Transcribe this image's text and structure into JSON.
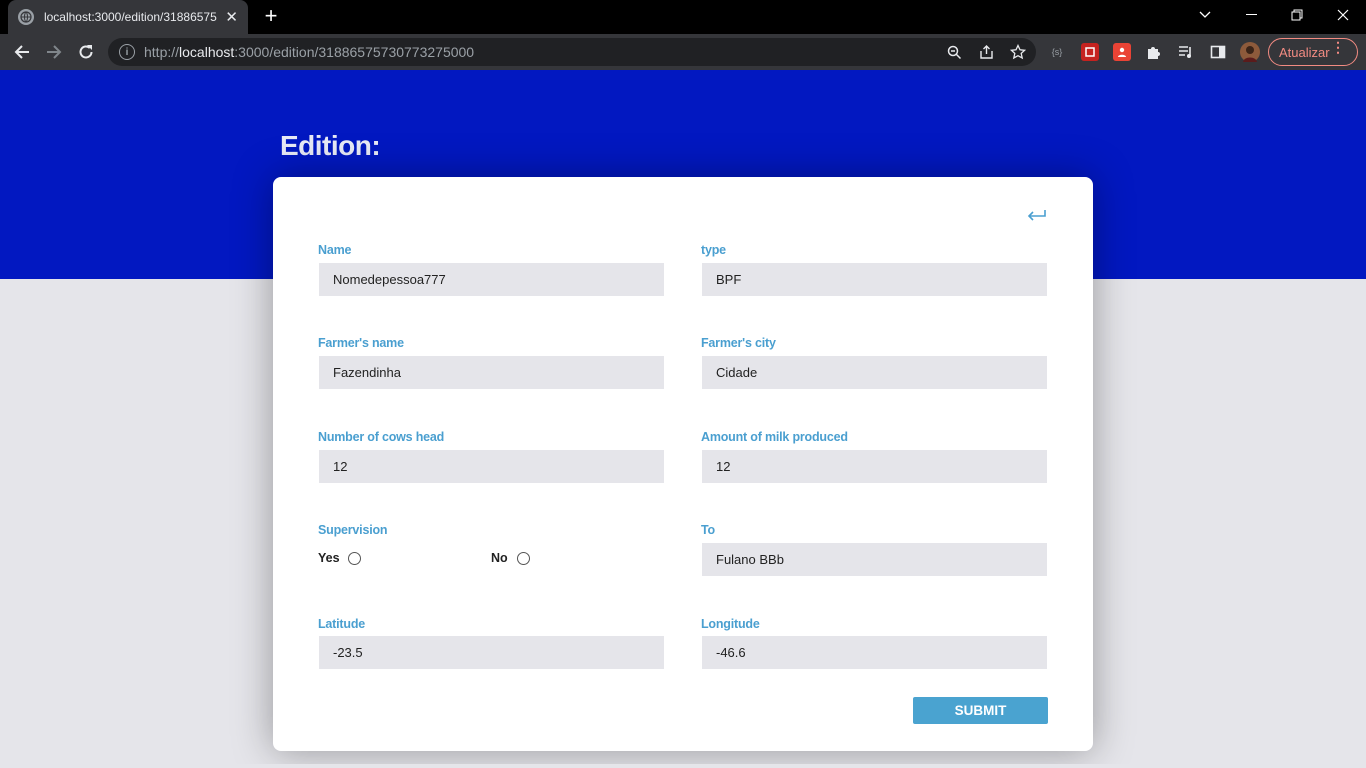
{
  "browser": {
    "tab_title": "localhost:3000/edition/31886575",
    "tab_close": "✕",
    "new_tab": "+",
    "url_scheme": "http://",
    "url_host": "localhost",
    "url_path": ":3000/edition/31886575730773275000",
    "update_label": "Atualizar",
    "update_dots": "⋮",
    "ext_s_label": "{s}"
  },
  "page": {
    "title": "Edition:"
  },
  "form": {
    "name": {
      "label": "Name",
      "value": "Nomedepessoa777"
    },
    "type": {
      "label": "type",
      "value": "BPF"
    },
    "farmer_name": {
      "label": "Farmer's name",
      "value": "Fazendinha"
    },
    "farmer_city": {
      "label": "Farmer's city",
      "value": "Cidade"
    },
    "cows": {
      "label": "Number of cows head",
      "value": "12"
    },
    "milk": {
      "label": "Amount of milk produced",
      "value": "12"
    },
    "supervision": {
      "label": "Supervision",
      "yes": "Yes",
      "no": "No"
    },
    "to": {
      "label": "To",
      "value": "Fulano BBb"
    },
    "latitude": {
      "label": "Latitude",
      "value": "-23.5"
    },
    "longitude": {
      "label": "Longitude",
      "value": "-46.6"
    },
    "submit_label": "SUBMIT"
  },
  "colors": {
    "hero": "#0218c1",
    "label": "#4a9fd0",
    "submit": "#4aa3d0",
    "input_bg": "#e5e5ea"
  },
  "icons": {
    "back": "return-arrow-icon",
    "browser_back": "arrow-left-icon",
    "browser_forward": "arrow-right-icon",
    "reload": "reload-icon",
    "zoom": "zoom-icon",
    "share": "share-icon",
    "bookmark": "star-icon",
    "extensions": "puzzle-icon",
    "media": "media-list-icon",
    "sidepanel": "side-panel-icon",
    "profile": "avatar"
  }
}
